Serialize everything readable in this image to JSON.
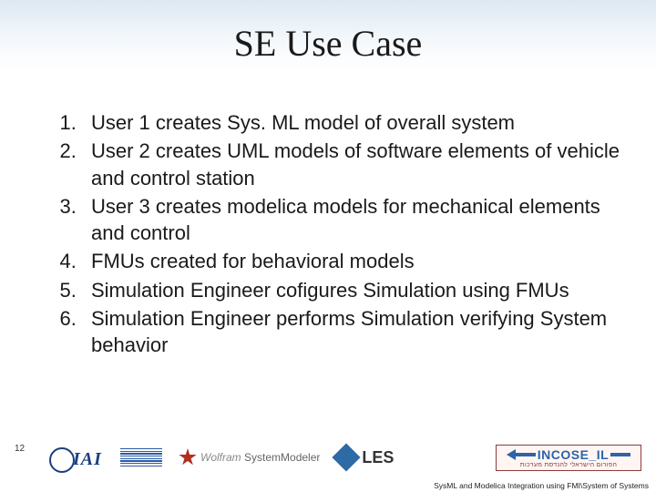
{
  "title": "SE Use Case",
  "list": {
    "i1": "User 1 creates Sys. ML model of overall system",
    "i2": "User 2 creates UML models of software elements of vehicle and control station",
    "i3": "User 3 creates modelica models for mechanical elements and control",
    "i4": "FMUs created for behavioral models",
    "i5": "Simulation Engineer cofigures Simulation using FMUs",
    "i6": "Simulation Engineer performs Simulation verifying System behavior"
  },
  "page_number": "12",
  "logos": {
    "iai": "IAI",
    "wolfram_prefix": "Wolfram",
    "wolfram_name": "SystemModeler",
    "les": "LES",
    "incose": "INCOSE_IL",
    "incose_sub": "הפורום הישראלי להנדסת מערכות"
  },
  "footer": "SysML and Modelica Integration using FMI\\System of Systems"
}
